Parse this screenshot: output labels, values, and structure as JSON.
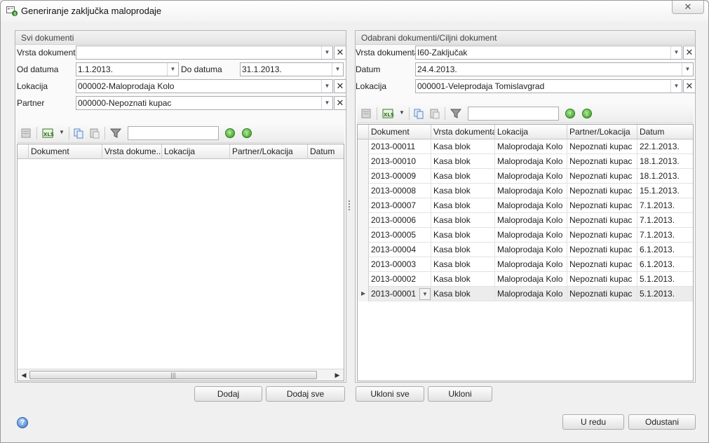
{
  "window": {
    "title": "Generiranje zaključka maloprodaje",
    "close_label": "✕"
  },
  "left": {
    "title": "Svi dokumenti",
    "vrsta_label": "Vrsta dokumenta",
    "vrsta_value": "",
    "od_label": "Od datuma",
    "od_value": "1.1.2013.",
    "do_label": "Do datuma",
    "do_value": "31.1.2013.",
    "lokacija_label": "Lokacija",
    "lokacija_value": "000002-Maloprodaja Kolo",
    "partner_label": "Partner",
    "partner_value": "000000-Nepoznati kupac",
    "search_value": "",
    "columns": [
      "Dokument",
      "Vrsta dokume...",
      "Lokacija",
      "Partner/Lokacija",
      "Datum"
    ],
    "rows": []
  },
  "right": {
    "title": "Odabrani dokumenti/Ciljni dokument",
    "vrsta_label": "Vrsta dokumenta",
    "vrsta_value": "I60-Zaključak",
    "datum_label": "Datum",
    "datum_value": "24.4.2013.",
    "lokacija_label": "Lokacija",
    "lokacija_value": "000001-Veleprodaja Tomislavgrad",
    "search_value": "",
    "columns": [
      "Dokument",
      "Vrsta dokumenta",
      "Lokacija",
      "Partner/Lokacija",
      "Datum"
    ],
    "rows": [
      [
        "2013-00011",
        "Kasa blok",
        "Maloprodaja Kolo",
        "Nepoznati kupac",
        "22.1.2013."
      ],
      [
        "2013-00010",
        "Kasa blok",
        "Maloprodaja Kolo",
        "Nepoznati kupac",
        "18.1.2013."
      ],
      [
        "2013-00009",
        "Kasa blok",
        "Maloprodaja Kolo",
        "Nepoznati kupac",
        "18.1.2013."
      ],
      [
        "2013-00008",
        "Kasa blok",
        "Maloprodaja Kolo",
        "Nepoznati kupac",
        "15.1.2013."
      ],
      [
        "2013-00007",
        "Kasa blok",
        "Maloprodaja Kolo",
        "Nepoznati kupac",
        "7.1.2013."
      ],
      [
        "2013-00006",
        "Kasa blok",
        "Maloprodaja Kolo",
        "Nepoznati kupac",
        "7.1.2013."
      ],
      [
        "2013-00005",
        "Kasa blok",
        "Maloprodaja Kolo",
        "Nepoznati kupac",
        "7.1.2013."
      ],
      [
        "2013-00004",
        "Kasa blok",
        "Maloprodaja Kolo",
        "Nepoznati kupac",
        "6.1.2013."
      ],
      [
        "2013-00003",
        "Kasa blok",
        "Maloprodaja Kolo",
        "Nepoznati kupac",
        "6.1.2013."
      ],
      [
        "2013-00002",
        "Kasa blok",
        "Maloprodaja Kolo",
        "Nepoznati kupac",
        "5.1.2013."
      ],
      [
        "2013-00001",
        "Kasa blok",
        "Maloprodaja Kolo",
        "Nepoznati kupac",
        "5.1.2013."
      ]
    ]
  },
  "buttons": {
    "dodaj": "Dodaj",
    "dodaj_sve": "Dodaj sve",
    "ukloni_sve": "Ukloni sve",
    "ukloni": "Ukloni",
    "u_redu": "U redu",
    "odustani": "Odustani"
  },
  "icons": {
    "help": "help-icon",
    "filter": "filter-icon",
    "excel": "excel-export-icon",
    "up": "move-up-icon",
    "down": "move-down-icon"
  }
}
